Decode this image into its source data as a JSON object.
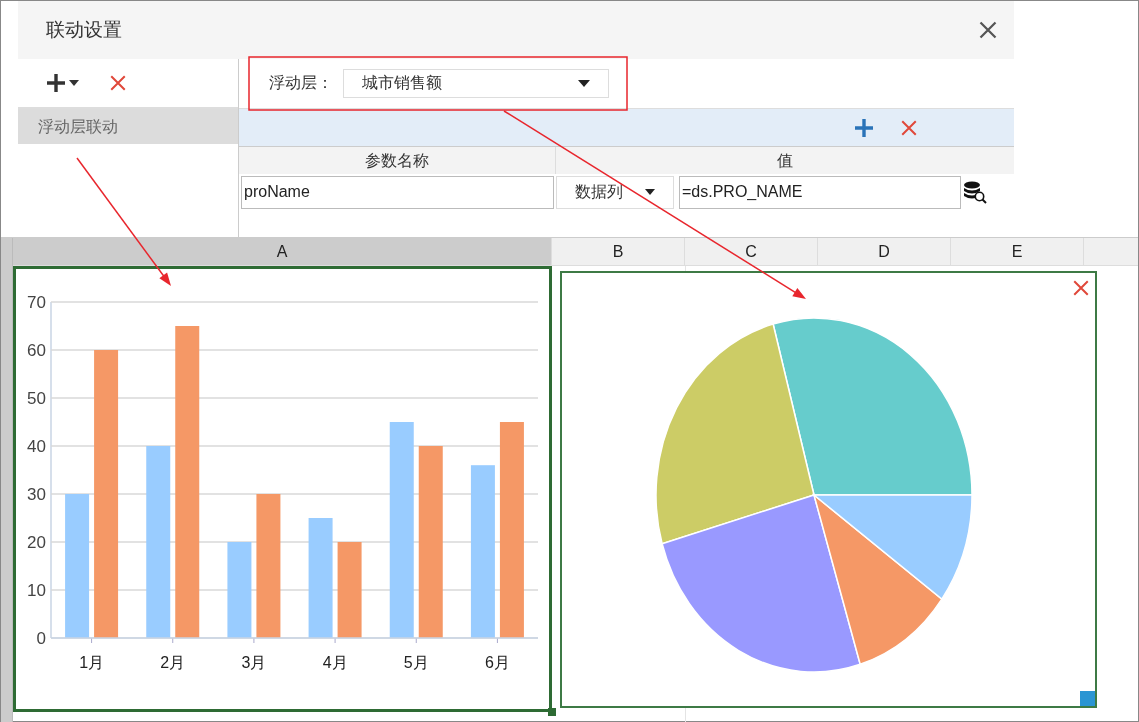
{
  "dialog": {
    "title": "联动设置"
  },
  "link_list": {
    "items": [
      {
        "label": "浮动层联动",
        "selected": true
      }
    ]
  },
  "float_layer": {
    "label": "浮动层：",
    "value": "城市销售额"
  },
  "param_table": {
    "columns": [
      "参数名称",
      "值"
    ],
    "rows": [
      {
        "name": "proName",
        "type": "数据列",
        "value": "=ds.PRO_NAME"
      }
    ]
  },
  "sheet": {
    "columns": [
      {
        "label": "A",
        "selected": true
      },
      {
        "label": "B",
        "selected": false
      },
      {
        "label": "C",
        "selected": false
      },
      {
        "label": "D",
        "selected": false
      },
      {
        "label": "E",
        "selected": false
      }
    ]
  },
  "bar_chart": {
    "chart_data": {
      "type": "bar",
      "categories": [
        "1月",
        "2月",
        "3月",
        "4月",
        "5月",
        "6月"
      ],
      "series": [
        {
          "color": "#99ccff",
          "values": [
            30,
            40,
            20,
            25,
            45,
            36
          ]
        },
        {
          "color": "#f59866",
          "values": [
            60,
            65,
            30,
            20,
            40,
            45
          ]
        }
      ],
      "grid": true,
      "ylim": [
        0,
        70
      ],
      "yticks": [
        0,
        10,
        20,
        30,
        40,
        50,
        60,
        70
      ]
    }
  }
}
